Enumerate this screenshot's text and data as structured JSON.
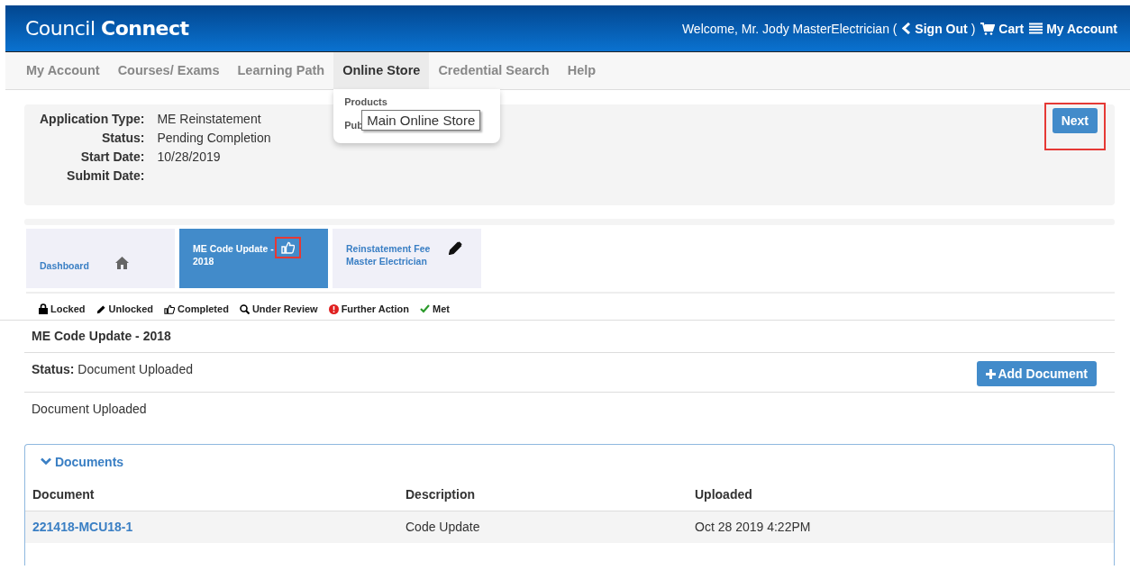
{
  "header": {
    "logo_light": "Council",
    "logo_bold": "Connect",
    "welcome": "Welcome, Mr. Jody MasterElectrician (",
    "sign_out": "Sign Out",
    "close_paren": ")",
    "cart": "Cart",
    "account": "My Account"
  },
  "nav": [
    {
      "label": "My Account",
      "selected": false
    },
    {
      "label": "Courses/ Exams",
      "selected": false
    },
    {
      "label": "Learning Path",
      "selected": false
    },
    {
      "label": "Online Store",
      "selected": true
    },
    {
      "label": "Credential Search",
      "selected": false
    },
    {
      "label": "Help",
      "selected": false
    }
  ],
  "dropdown": {
    "items": [
      "Products",
      "Pub"
    ],
    "tooltip": "Main Online Store"
  },
  "application": {
    "fields": [
      {
        "label": "Application Type:",
        "value": "ME Reinstatement"
      },
      {
        "label": "Status:",
        "value": "Pending Completion"
      },
      {
        "label": "Start Date:",
        "value": "10/28/2019"
      },
      {
        "label": "Submit Date:"
      }
    ],
    "next_button": "Next",
    "next_highlighted": true
  },
  "steps": [
    {
      "label": "Dashboard",
      "kind": "home",
      "selected": false,
      "highlighted": false
    },
    {
      "label": "ME Code Update - 2018",
      "kind": "thumb",
      "selected": true,
      "highlighted": true
    },
    {
      "label": "Reinstatement Fee Master Electrician",
      "kind": "pencil",
      "selected": false,
      "highlighted": false
    }
  ],
  "legend": [
    {
      "kind": "lock",
      "label": "Locked"
    },
    {
      "kind": "pencil",
      "label": "Unlocked"
    },
    {
      "kind": "thumb",
      "label": "Completed"
    },
    {
      "kind": "search",
      "label": "Under Review"
    },
    {
      "kind": "alert",
      "label": "Further Action"
    },
    {
      "kind": "check",
      "label": "Met"
    }
  ],
  "section": {
    "title": "ME Code Update - 2018",
    "status": "**Status:** Document Uploaded",
    "add_button": "Add Document",
    "note": "Document Uploaded"
  },
  "documents": {
    "title": "Documents",
    "expanded": true,
    "columns": [
      "Document",
      "Description",
      "Uploaded"
    ],
    "rows": [
      {
        "document": "221418-MCU18-1",
        "description": "Code Update",
        "uploaded": "Oct 28 2019 4:22PM"
      }
    ]
  }
}
